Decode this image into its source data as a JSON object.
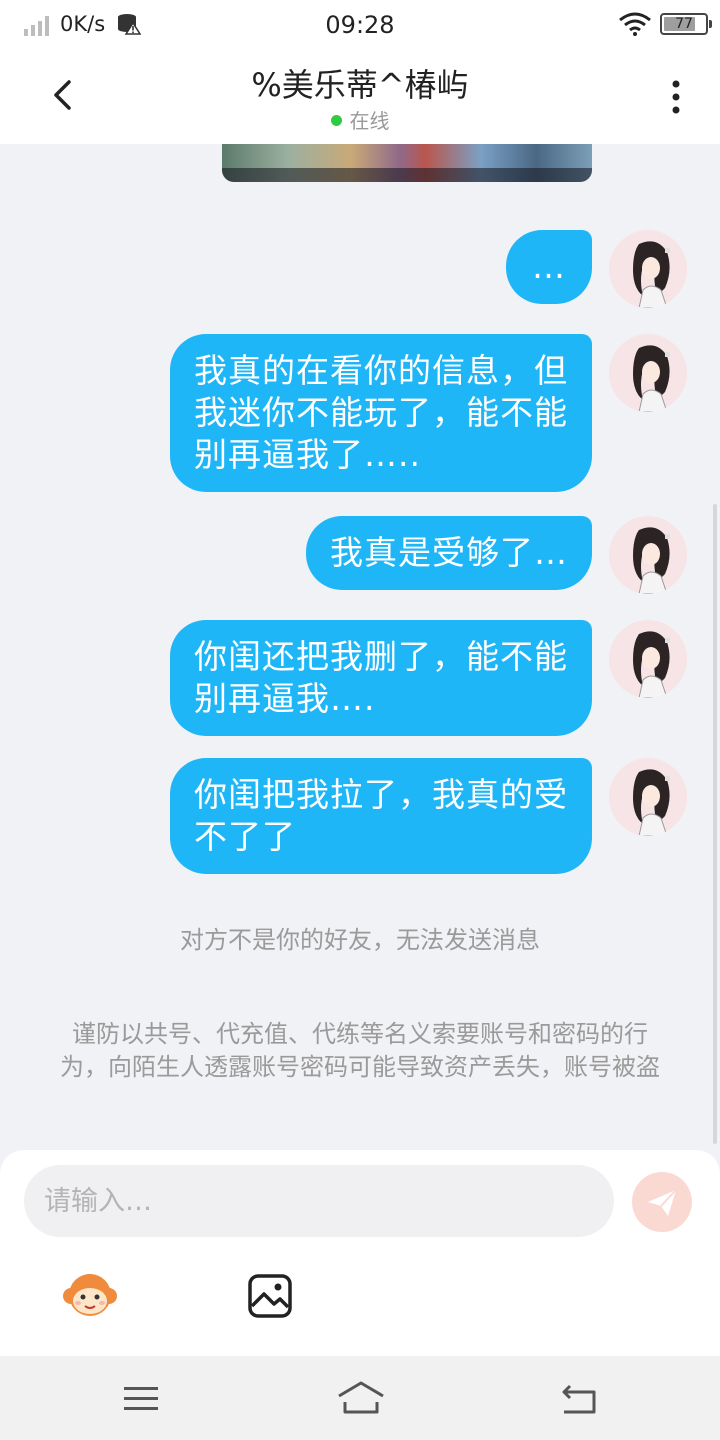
{
  "status_bar": {
    "speed": "0K/s",
    "time": "09:28",
    "battery_level": "77",
    "battery_fraction": 0.77
  },
  "header": {
    "title": "%美乐蒂^椿屿",
    "status": "在线",
    "back_icon": "chevron-left-icon",
    "more_icon": "vertical-dots-icon"
  },
  "messages": [
    {
      "text": "…"
    },
    {
      "text": "我真的在看你的信息，但\n我迷你不能玩了，能不能\n别再逼我了….."
    },
    {
      "text": "我真是受够了…"
    },
    {
      "text": "你闺还把我删了，能不能\n别再逼我…."
    },
    {
      "text": "你闺把我拉了，我真的受\n不了了"
    }
  ],
  "system_note": "对方不是你的好友，无法发送消息",
  "warning_note": "谨防以共号、代充值、代练等名义索要账号和密码的行为，向陌生人透露账号密码可能导致资产丢失，账号被盗",
  "composer": {
    "placeholder": "请输入…",
    "send_icon": "paper-plane-icon",
    "emoji_icon": "monkey-face-icon",
    "image_icon": "image-icon"
  },
  "nav": {
    "menu_icon": "menu-icon",
    "home_icon": "home-icon",
    "back_icon": "back-icon"
  },
  "colors": {
    "bubble": "#1fb6f8",
    "send_button": "#fbd9d3",
    "online": "#2ecc40"
  }
}
